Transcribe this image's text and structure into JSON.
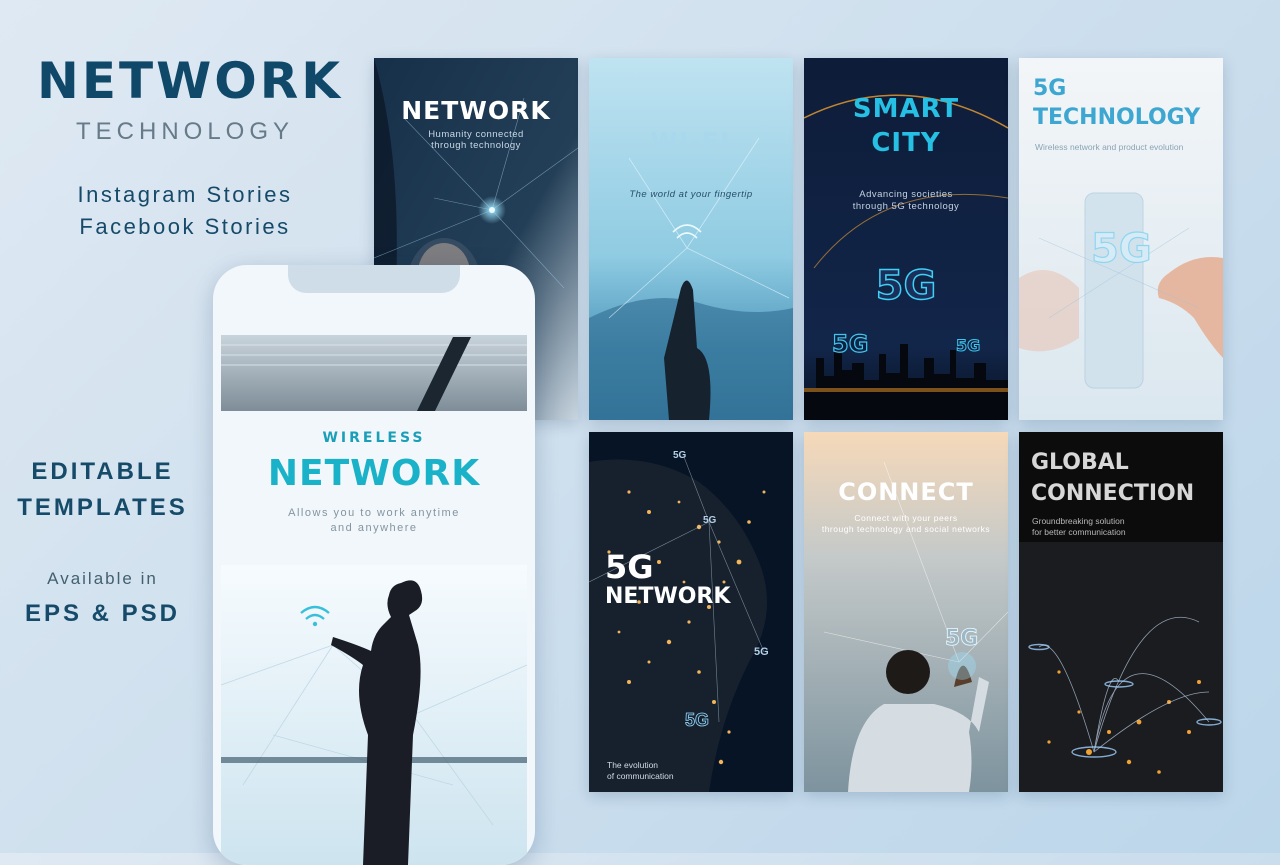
{
  "promo": {
    "title": "NETWORK",
    "subtitle": "TECHNOLOGY",
    "line1": "Instagram Stories",
    "line2": "Facebook  Stories",
    "editable1": "EDITABLE",
    "editable2": "TEMPLATES",
    "available": "Available in",
    "formats": "EPS & PSD"
  },
  "cards": {
    "network": {
      "title": "NETWORK",
      "sub1": "Humanity connected",
      "sub2": "through technology"
    },
    "wifi": {
      "title": "WI-FI",
      "sub": "The world at your fingertip"
    },
    "smart_city": {
      "title1": "SMART",
      "title2": "CITY",
      "sub1": "Advancing societies",
      "sub2": "through 5G technology",
      "badge_big": "5G",
      "badge_left": "5G",
      "badge_right": "5G"
    },
    "tech5g": {
      "title1": "5G",
      "title2": "TECHNOLOGY",
      "sub": "Wireless network and product evolution",
      "badge": "5G"
    },
    "network5g": {
      "title1": "5G",
      "title2": "NETWORK",
      "sub1": "The evolution",
      "sub2": "of communication",
      "badges": [
        "5G",
        "5G",
        "5G",
        "5G"
      ]
    },
    "connect": {
      "title": "CONNECT",
      "sub1": "Connect with your peers",
      "sub2": "through technology and social networks",
      "badge": "5G"
    },
    "global": {
      "title1": "GLOBAL",
      "title2": "CONNECTION",
      "sub1": "Groundbreaking solution",
      "sub2": "for better communication"
    }
  },
  "phone": {
    "kicker": "WIRELESS",
    "title": "NETWORK",
    "sub1": "Allows you to work anytime",
    "sub2": "and anywhere"
  },
  "colors": {
    "navy": "#0f4868",
    "teal": "#1ab2c8",
    "cyan_title": "#2bb8d8"
  }
}
